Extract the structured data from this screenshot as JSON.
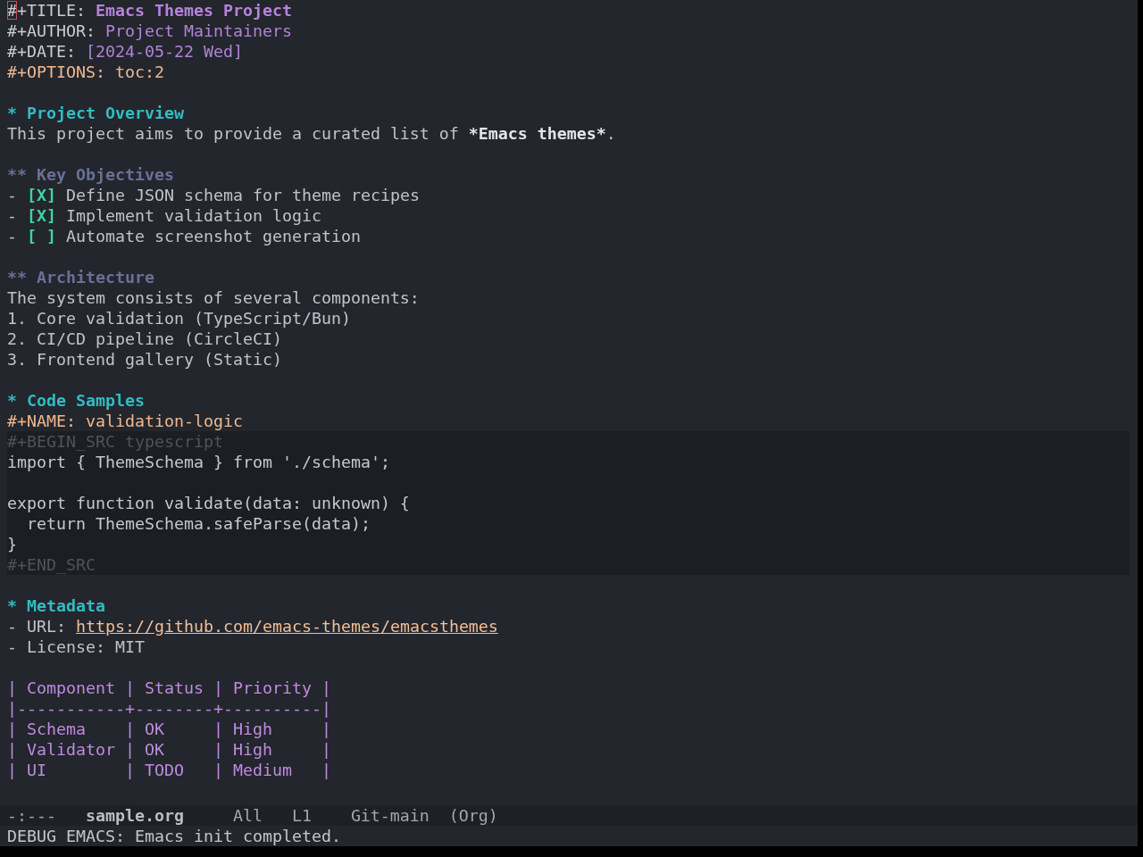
{
  "buffer": {
    "cursor_visible": true,
    "keywords": [
      {
        "kind": "title",
        "keyword": "#+TITLE:",
        "value": "Emacs Themes Project"
      },
      {
        "kind": "author",
        "keyword": "#+AUTHOR:",
        "value": "Project Maintainers"
      },
      {
        "kind": "date",
        "keyword": "#+DATE:",
        "value": "[2024-05-22 Wed]"
      },
      {
        "kind": "options",
        "keyword": "#+OPTIONS:",
        "value": "toc:2"
      }
    ],
    "sections": [
      {
        "kind": "h1",
        "heading": "* Project Overview",
        "blocks": [
          {
            "kind": "paragraph",
            "segments": [
              {
                "text": "This project aims to provide a curated list of ",
                "bold": false
              },
              {
                "text": "*Emacs themes*",
                "bold": true
              },
              {
                "text": ".",
                "bold": false
              }
            ]
          }
        ]
      },
      {
        "kind": "h2",
        "heading": "** Key Objectives",
        "blocks": [
          {
            "kind": "checklist",
            "items": [
              {
                "bullet": "-",
                "checkbox": "[X]",
                "text": "Define JSON schema for theme recipes"
              },
              {
                "bullet": "-",
                "checkbox": "[X]",
                "text": "Implement validation logic"
              },
              {
                "bullet": "-",
                "checkbox": "[ ]",
                "text": "Automate screenshot generation"
              }
            ]
          }
        ]
      },
      {
        "kind": "h2",
        "heading": "** Architecture",
        "blocks": [
          {
            "kind": "numbered",
            "intro": "The system consists of several components:",
            "items": [
              {
                "number": "1.",
                "text": "Core validation (TypeScript/Bun)"
              },
              {
                "number": "2.",
                "text": "CI/CD pipeline (CircleCI)"
              },
              {
                "number": "3.",
                "text": "Frontend gallery (Static)"
              }
            ]
          }
        ]
      },
      {
        "kind": "h1",
        "heading": "* Code Samples",
        "blocks": [
          {
            "kind": "src",
            "name_keyword": "#+NAME:",
            "name": "validation-logic",
            "begin": "#+BEGIN_SRC typescript",
            "code_groups": [
              [
                "import { ThemeSchema } from './schema';"
              ],
              [
                "export function validate(data: unknown) {",
                "  return ThemeSchema.safeParse(data);",
                "}"
              ]
            ],
            "end": "#+END_SRC"
          }
        ]
      },
      {
        "kind": "h1",
        "heading": "* Metadata",
        "blocks": [
          {
            "kind": "bullets",
            "items": [
              {
                "bullet": "-",
                "text": "URL:",
                "link": "https://github.com/emacs-themes/emacsthemes"
              },
              {
                "bullet": "-",
                "text": "License: MIT"
              }
            ]
          },
          {
            "kind": "table",
            "header": "| Component | Status | Priority |",
            "rule": "|-----------+--------+----------|",
            "rows": [
              "| Schema    | OK     | High     |",
              "| Validator | OK     | High     |",
              "| UI        | TODO   | Medium   |"
            ]
          }
        ]
      }
    ]
  },
  "mode_line": {
    "items": [
      {
        "kind": "status",
        "text": "-:---"
      },
      {
        "kind": "buffer",
        "text": "sample.org"
      },
      {
        "kind": "position",
        "text": "All"
      },
      {
        "kind": "line",
        "text": "L1"
      },
      {
        "kind": "vc",
        "text": "Git-main"
      },
      {
        "kind": "mode",
        "text": "(Org)"
      }
    ]
  },
  "echo_area": {
    "message": "DEBUG EMACS: Emacs init completed."
  }
}
